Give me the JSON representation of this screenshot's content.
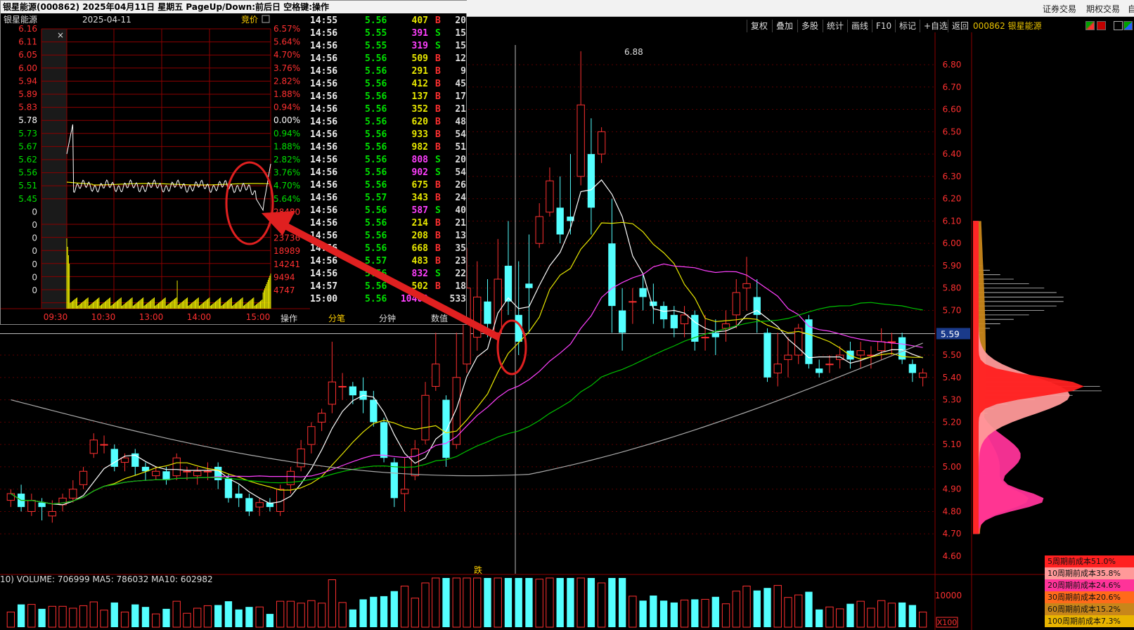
{
  "topbar": {
    "items": [
      "证券交易",
      "期权交易",
      "自"
    ]
  },
  "toolbar": {
    "buttons": [
      "复权",
      "叠加",
      "多股",
      "统计",
      "画线",
      "F10",
      "标记",
      "+自选",
      "返回"
    ],
    "stock_code": "000862 银星能源"
  },
  "popup": {
    "title": "银星能源(000862) 2025年04月11日 星期五 PageUp/Down:前后日 空格键:操作",
    "stock_name": "银星能源",
    "date": "2025-04-11",
    "auction_label": "竞价",
    "close_label": "×",
    "price_axis": [
      "6.16",
      "6.11",
      "6.05",
      "6.00",
      "5.94",
      "5.89",
      "5.83",
      "5.78",
      "5.73",
      "5.67",
      "5.62",
      "5.56",
      "5.51",
      "5.45",
      "0",
      "0",
      "0",
      "0",
      "0",
      "0",
      "0"
    ],
    "pct_axis": [
      "6.57%",
      "5.64%",
      "4.70%",
      "3.76%",
      "2.82%",
      "1.88%",
      "0.94%",
      "0.00%",
      "0.94%",
      "1.88%",
      "2.82%",
      "3.76%",
      "4.70%",
      "5.64%",
      "28480",
      "",
      "23736",
      "18989",
      "14241",
      "9494",
      "4747"
    ],
    "time_axis": [
      "09:30",
      "10:30",
      "13:00",
      "14:00",
      "15:00"
    ],
    "tabs": [
      "操作",
      "分笔",
      "分钟",
      "数值"
    ],
    "trades": [
      {
        "time": "14:55",
        "price": "5.56",
        "vol": "407",
        "bs": "B",
        "num": "20"
      },
      {
        "time": "14:56",
        "price": "5.55",
        "vol": "391",
        "bs": "S",
        "num": "15"
      },
      {
        "time": "14:56",
        "price": "5.55",
        "vol": "319",
        "bs": "S",
        "num": "15"
      },
      {
        "time": "14:56",
        "price": "5.56",
        "vol": "509",
        "bs": "B",
        "num": "12"
      },
      {
        "time": "14:56",
        "price": "5.56",
        "vol": "291",
        "bs": "B",
        "num": "9"
      },
      {
        "time": "14:56",
        "price": "5.56",
        "vol": "412",
        "bs": "B",
        "num": "45"
      },
      {
        "time": "14:56",
        "price": "5.56",
        "vol": "137",
        "bs": "B",
        "num": "17"
      },
      {
        "time": "14:56",
        "price": "5.56",
        "vol": "352",
        "bs": "B",
        "num": "21"
      },
      {
        "time": "14:56",
        "price": "5.56",
        "vol": "620",
        "bs": "B",
        "num": "48"
      },
      {
        "time": "14:56",
        "price": "5.56",
        "vol": "933",
        "bs": "B",
        "num": "54"
      },
      {
        "time": "14:56",
        "price": "5.56",
        "vol": "982",
        "bs": "B",
        "num": "51"
      },
      {
        "time": "14:56",
        "price": "5.56",
        "vol": "808",
        "bs": "S",
        "num": "20"
      },
      {
        "time": "14:56",
        "price": "5.56",
        "vol": "902",
        "bs": "S",
        "num": "54"
      },
      {
        "time": "14:56",
        "price": "5.56",
        "vol": "675",
        "bs": "B",
        "num": "26"
      },
      {
        "time": "14:56",
        "price": "5.57",
        "vol": "343",
        "bs": "B",
        "num": "24"
      },
      {
        "time": "14:56",
        "price": "5.56",
        "vol": "587",
        "bs": "S",
        "num": "40"
      },
      {
        "time": "14:56",
        "price": "5.56",
        "vol": "214",
        "bs": "B",
        "num": "21"
      },
      {
        "time": "14:56",
        "price": "5.56",
        "vol": "208",
        "bs": "B",
        "num": "13"
      },
      {
        "time": "14:56",
        "price": "5.56",
        "vol": "668",
        "bs": "B",
        "num": "35"
      },
      {
        "time": "14:56",
        "price": "5.57",
        "vol": "483",
        "bs": "B",
        "num": "23"
      },
      {
        "time": "14:56",
        "price": "5.56",
        "vol": "832",
        "bs": "S",
        "num": "22"
      },
      {
        "time": "14:57",
        "price": "5.56",
        "vol": "502",
        "bs": "B",
        "num": "18"
      },
      {
        "time": "15:00",
        "price": "5.56",
        "vol": "10409",
        "bs": "",
        "num": "533"
      }
    ]
  },
  "kline": {
    "price_axis": [
      "6.80",
      "6.70",
      "6.60",
      "6.50",
      "6.40",
      "6.30",
      "6.20",
      "6.10",
      "6.00",
      "5.90",
      "5.80",
      "5.70",
      "5.50",
      "5.40",
      "5.30",
      "5.20",
      "5.10",
      "5.00",
      "4.90",
      "4.80",
      "4.70",
      "4.60"
    ],
    "current_price": "5.59",
    "high_label": "6.88",
    "marker_label": "跌",
    "volume_axis": "10000",
    "volume_scale": "X100"
  },
  "volume_label": "10) VOLUME: 706999  MA5: 786032  MA10: 602982",
  "cost_legend": [
    {
      "label": "5周期前成本51.0%",
      "color": "#ff2020"
    },
    {
      "label": "10周期前成本35.8%",
      "color": "#ff9999"
    },
    {
      "label": "20周期前成本24.6%",
      "color": "#ff3399"
    },
    {
      "label": "30周期前成本20.6%",
      "color": "#ff6a1a"
    },
    {
      "label": "60周期前成本15.2%",
      "color": "#c8861a"
    },
    {
      "label": "100周期前成本7.3%",
      "color": "#e8b400"
    }
  ],
  "colors": {
    "up": "#ff3030",
    "down": "#54ffff",
    "ma5": "#ffffff",
    "ma10": "#e8e800",
    "ma20": "#ff40ff",
    "ma60": "#00c000",
    "ma120": "#aaaaaa",
    "annotation": "#e02020"
  }
}
